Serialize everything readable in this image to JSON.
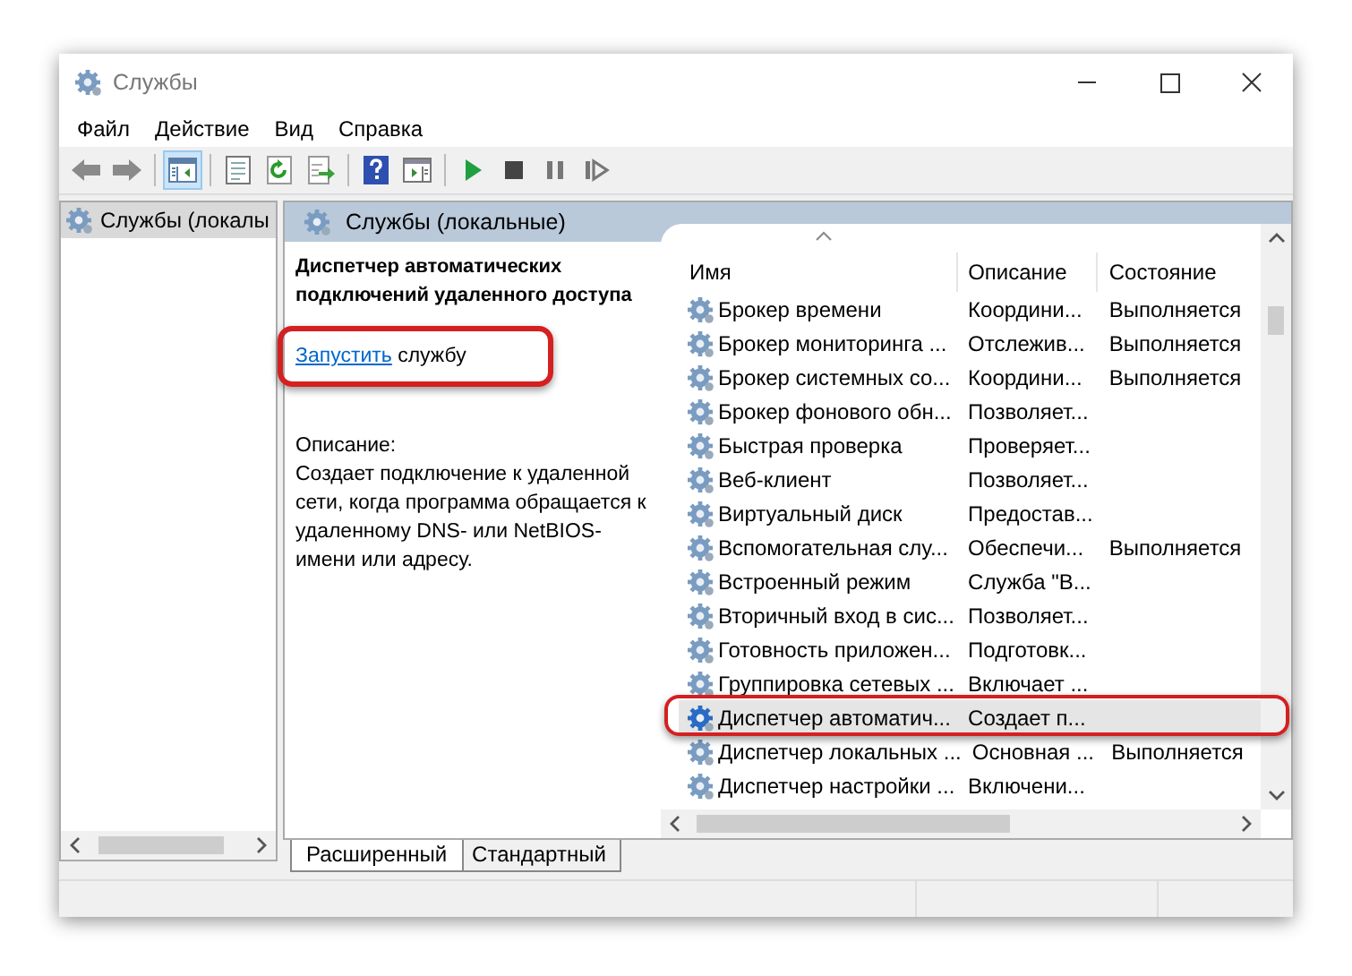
{
  "window": {
    "title": "Службы"
  },
  "menu": [
    "Файл",
    "Действие",
    "Вид",
    "Справка"
  ],
  "toolbar": [
    {
      "kind": "back",
      "selected": false
    },
    {
      "kind": "forward",
      "selected": false
    },
    {
      "kind": "sep"
    },
    {
      "kind": "tree",
      "selected": true
    },
    {
      "kind": "sep"
    },
    {
      "kind": "properties",
      "selected": false
    },
    {
      "kind": "refresh",
      "selected": false
    },
    {
      "kind": "export",
      "selected": false
    },
    {
      "kind": "sep"
    },
    {
      "kind": "help",
      "selected": false
    },
    {
      "kind": "console",
      "selected": false
    },
    {
      "kind": "sep"
    },
    {
      "kind": "start",
      "selected": false
    },
    {
      "kind": "stop",
      "selected": false
    },
    {
      "kind": "pause",
      "selected": false
    },
    {
      "kind": "resume",
      "selected": false
    }
  ],
  "tree": {
    "items": [
      {
        "label": "Службы (локалы",
        "selected": true
      }
    ]
  },
  "pane": {
    "title": "Службы (локальные)"
  },
  "details": {
    "service_name": "Диспетчер автоматических подключений удаленного доступа",
    "action_link": "Запустить",
    "action_rest": "службу",
    "action_highlighted": true,
    "description_label": "Описание:",
    "description": "Создает подключение к удаленной сети, когда программа обращается к удаленному DNS- или NetBIOS-имени или адресу."
  },
  "table": {
    "columns": [
      {
        "label": "Имя",
        "sorted": true
      },
      {
        "label": "Описание",
        "sorted": false
      },
      {
        "label": "Состояние",
        "sorted": false
      }
    ],
    "rows": [
      {
        "name": "Брокер времени",
        "description": "Координи...",
        "status": "Выполняется",
        "selected": false,
        "highlighted": false
      },
      {
        "name": "Брокер мониторинга ...",
        "description": "Отслежив...",
        "status": "Выполняется",
        "selected": false,
        "highlighted": false
      },
      {
        "name": "Брокер системных со...",
        "description": "Координи...",
        "status": "Выполняется",
        "selected": false,
        "highlighted": false
      },
      {
        "name": "Брокер фонового обн...",
        "description": "Позволяет...",
        "selected": false,
        "highlighted": false
      },
      {
        "name": "Быстрая проверка",
        "description": "Проверяет...",
        "selected": false,
        "highlighted": false
      },
      {
        "name": "Веб-клиент",
        "description": "Позволяет...",
        "selected": false,
        "highlighted": false
      },
      {
        "name": "Виртуальный диск",
        "description": "Предостав...",
        "selected": false,
        "highlighted": false
      },
      {
        "name": "Вспомогательная слу...",
        "description": "Обеспечи...",
        "status": "Выполняется",
        "selected": false,
        "highlighted": false
      },
      {
        "name": "Встроенный режим",
        "description": "Служба \"В...",
        "selected": false,
        "highlighted": false
      },
      {
        "name": "Вторичный вход в сис...",
        "description": "Позволяет...",
        "selected": false,
        "highlighted": false
      },
      {
        "name": "Готовность приложен...",
        "description": "Подготовк...",
        "selected": false,
        "highlighted": false
      },
      {
        "name": "Группировка сетевых ...",
        "description": "Включает ...",
        "selected": false,
        "highlighted": false
      },
      {
        "name": "Диспетчер автоматич...",
        "description": "Создает п...",
        "selected": true,
        "highlighted": true
      },
      {
        "name": "Диспетчер локальных ...",
        "description": "Основная ...",
        "status": "Выполняется",
        "selected": false,
        "highlighted": false
      },
      {
        "name": "Диспетчер настройки ...",
        "description": "Включени...",
        "selected": false,
        "highlighted": false
      }
    ]
  },
  "tabs": [
    {
      "label": "Расширенный",
      "selected": true
    },
    {
      "label": "Стандартный",
      "selected": false
    }
  ]
}
